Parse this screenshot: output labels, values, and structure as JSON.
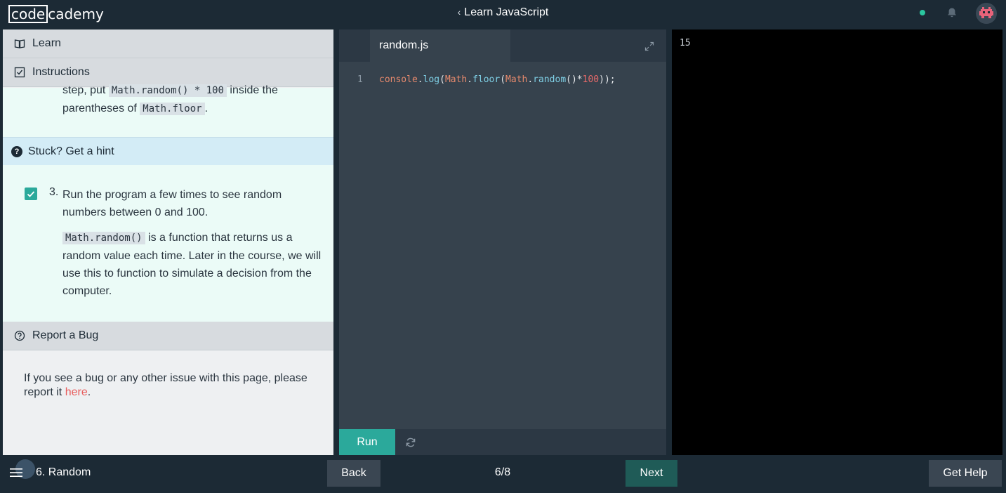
{
  "header": {
    "logo_box": "code",
    "logo_rest": "cademy",
    "course_title": "Learn JavaScript",
    "back_chevron": "‹"
  },
  "left_panel": {
    "learn_label": "Learn",
    "instructions_label": "Instructions",
    "step2": {
      "text_before": "step, put ",
      "code1": "Math.random() * 100",
      "text_mid": " inside the parentheses of ",
      "code2": "Math.floor",
      "text_after": "."
    },
    "hint_label": "Stuck? Get a hint",
    "step3": {
      "number": "3.",
      "checked": true,
      "text": "Run the program a few times to see random numbers between 0 and 100.",
      "code": "Math.random()",
      "text2": " is a function that returns us a random value each time. Later in the course, we will use this to function to simulate a decision from the computer."
    },
    "bug_label": "Report a Bug",
    "bug_text": "If you see a bug or any other issue with this page, please report it ",
    "bug_link": "here",
    "bug_end": "."
  },
  "editor": {
    "filename": "random.js",
    "line_number": "1",
    "code_tokens": [
      {
        "t": "console",
        "c": "k-console"
      },
      {
        "t": ".",
        "c": "k-paren"
      },
      {
        "t": "log",
        "c": "k-fn"
      },
      {
        "t": "(",
        "c": "k-paren"
      },
      {
        "t": "Math",
        "c": "k-console"
      },
      {
        "t": ".",
        "c": "k-paren"
      },
      {
        "t": "floor",
        "c": "k-fn"
      },
      {
        "t": "(",
        "c": "k-paren"
      },
      {
        "t": "Math",
        "c": "k-console"
      },
      {
        "t": ".",
        "c": "k-paren"
      },
      {
        "t": "random",
        "c": "k-fn"
      },
      {
        "t": "()*",
        "c": "k-paren"
      },
      {
        "t": "100",
        "c": "k-num"
      },
      {
        "t": "));",
        "c": "k-paren"
      }
    ],
    "run_label": "Run"
  },
  "output": {
    "text": "15"
  },
  "footer": {
    "lesson": "6. Random",
    "back_label": "Back",
    "page_indicator": "6/8",
    "next_label": "Next",
    "help_label": "Get Help"
  },
  "colors": {
    "accent": "#2ba99b",
    "topbar": "#1c2a35",
    "editor_bg": "#36424d",
    "output_bg": "#000000",
    "link": "#e85d5d",
    "status_dot": "#2bc7a0"
  }
}
